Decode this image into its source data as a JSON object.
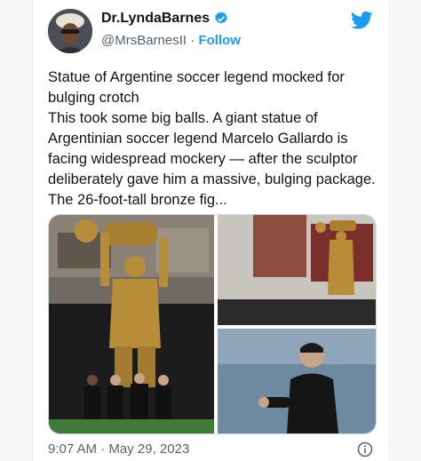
{
  "author": {
    "display_name": "Dr.LyndaBarnes",
    "handle": "@MrsBarnesII",
    "separator": "·",
    "follow_label": "Follow",
    "verified": true
  },
  "tweet": {
    "text": "Statue of Argentine soccer legend mocked for bulging crotch\nThis took some big balls. A giant statue of Argentinian soccer legend Marcelo Gallardo is facing widespread mockery — after the sculptor deliberately gave him a massive, bulging package.\nThe 26-foot-tall bronze fig...",
    "time": "9:07 AM",
    "date": "May 29, 2023"
  },
  "icons": {
    "verified": "verified-badge-icon",
    "brand": "twitter-bird-icon",
    "info": "info-icon"
  },
  "colors": {
    "accent": "#1d9bf0",
    "secondary_text": "#536471",
    "statue_gold": "#b88d3a"
  }
}
